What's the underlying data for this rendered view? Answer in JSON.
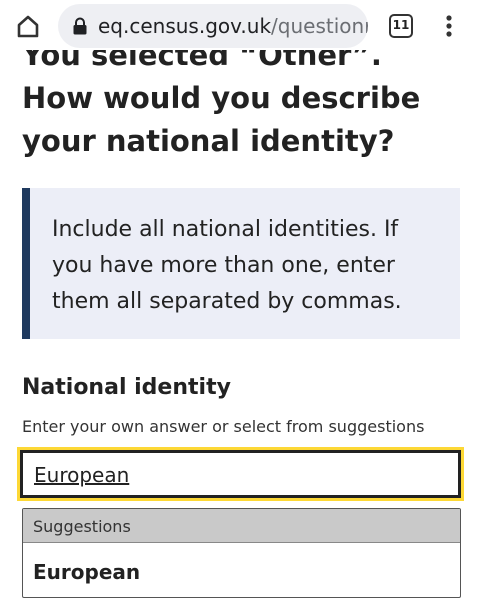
{
  "browser": {
    "url_host": "eq.census.gov.uk",
    "url_path": "/questionr",
    "tab_count": "11"
  },
  "question": {
    "title": "You selected “Other”. How would you describe your national identity?",
    "panel_text": "Include all national identities. If you have more than one, enter them all separated by commas."
  },
  "field": {
    "label": "National identity",
    "hint": "Enter your own answer or select from suggestions",
    "value": "European"
  },
  "suggestions": {
    "header": "Suggestions",
    "options": [
      "European"
    ]
  },
  "colors": {
    "panel_border": "#1f3a5f",
    "panel_bg": "#eceef7",
    "focus": "#fdd835"
  }
}
